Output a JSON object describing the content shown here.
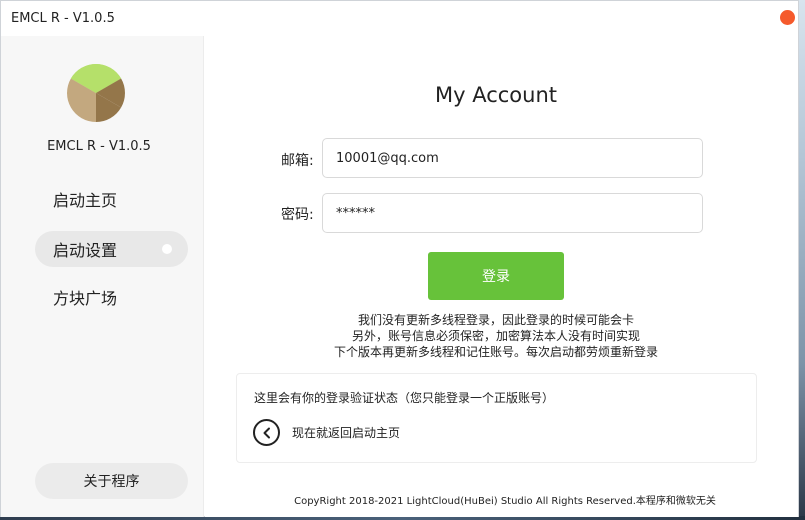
{
  "window": {
    "title": "EMCL R - V1.0.5"
  },
  "sidebar": {
    "app_name": "EMCL R - V1.0.5",
    "items": [
      {
        "label": "启动主页"
      },
      {
        "label": "启动设置"
      },
      {
        "label": "方块广场"
      }
    ],
    "about_label": "关于程序"
  },
  "main": {
    "title": "My Account",
    "email": {
      "label": "邮箱:",
      "value": "10001@qq.com"
    },
    "password": {
      "label": "密码:",
      "value": "******"
    },
    "login_label": "登录",
    "notice": [
      "我们没有更新多线程登录，因此登录的时候可能会卡",
      "另外，账号信息必须保密，加密算法本人没有时间实现",
      "下个版本再更新多线程和记住账号。每次启动都劳烦重新登录"
    ],
    "status": {
      "text": "这里会有你的登录验证状态（您只能登录一个正版账号）",
      "back_label": "现在就返回启动主页"
    },
    "footer": "CopyRight 2018-2021 LightCloud(HuBei) Studio All Rights Reserved.本程序和微软无关"
  },
  "colors": {
    "accent_green": "#67c23a",
    "close_red": "#f55a2c",
    "logo_green": "#b5e06a",
    "logo_tan": "#c3a87f",
    "logo_brown": "#94764a"
  },
  "icons": {
    "close": "close-icon",
    "logo": "logo-icon",
    "back": "chevron-left-icon"
  }
}
